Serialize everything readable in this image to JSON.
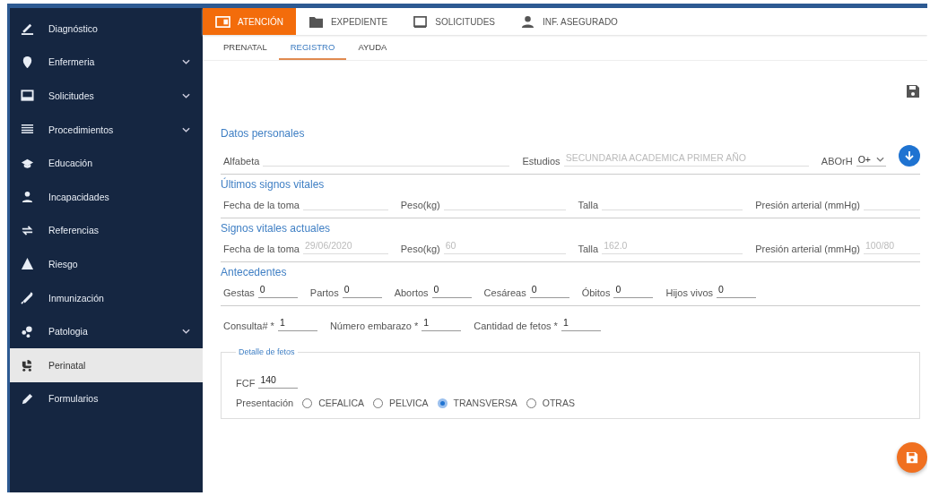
{
  "sidebar": {
    "items": [
      {
        "label": "Diagnóstico",
        "has_submenu": false,
        "selected": false
      },
      {
        "label": "Enfermeria",
        "has_submenu": true,
        "selected": false
      },
      {
        "label": "Solicitudes",
        "has_submenu": true,
        "selected": false
      },
      {
        "label": "Procedimientos",
        "has_submenu": true,
        "selected": false
      },
      {
        "label": "Educación",
        "has_submenu": false,
        "selected": false
      },
      {
        "label": "Incapacidades",
        "has_submenu": false,
        "selected": false
      },
      {
        "label": "Referencias",
        "has_submenu": false,
        "selected": false
      },
      {
        "label": "Riesgo",
        "has_submenu": false,
        "selected": false
      },
      {
        "label": "Inmunización",
        "has_submenu": false,
        "selected": false
      },
      {
        "label": "Patologia",
        "has_submenu": true,
        "selected": false
      },
      {
        "label": "Perinatal",
        "has_submenu": false,
        "selected": true
      },
      {
        "label": "Formularios",
        "has_submenu": false,
        "selected": false
      }
    ]
  },
  "top_tabs": [
    {
      "label": "ATENCIÓN",
      "selected": true
    },
    {
      "label": "EXPEDIENTE",
      "selected": false
    },
    {
      "label": "SOLICITUDES",
      "selected": false
    },
    {
      "label": "INF. ASEGURADO",
      "selected": false
    }
  ],
  "sub_tabs": [
    {
      "label": "PRENATAL",
      "selected": false
    },
    {
      "label": "REGISTRO",
      "selected": true
    },
    {
      "label": "AYUDA",
      "selected": false
    }
  ],
  "sections": [
    {
      "title": "Datos personales",
      "fields": [
        {
          "kind": "text",
          "label": "Alfabeta"
        },
        {
          "kind": "text",
          "label": "Estudios",
          "value": "SECUNDARIA ACADEMICA PRIMER AÑO",
          "disabled": true
        },
        {
          "kind": "select",
          "label": "ABOrH",
          "value": "O+"
        },
        {
          "kind": "button"
        }
      ]
    },
    {
      "title": "Últimos signos vitales",
      "fields": [
        {
          "kind": "text",
          "label": "Fecha de la toma"
        },
        {
          "kind": "text",
          "label": "Peso(kg)"
        },
        {
          "kind": "text",
          "label": "Talla"
        },
        {
          "kind": "text",
          "label": "Presión arterial (mmHg)"
        }
      ]
    },
    {
      "title": "Signos vitales actuales",
      "fields": [
        {
          "kind": "text",
          "label": "Fecha de la toma",
          "value": "29/06/2020",
          "disabled": true
        },
        {
          "kind": "text",
          "label": "Peso(kg)",
          "value": "60",
          "disabled": true
        },
        {
          "kind": "text",
          "label": "Talla",
          "value": "162.0",
          "disabled": true
        },
        {
          "kind": "text",
          "label": "Presión arterial (mmHg)",
          "value": "100/80",
          "disabled": true
        }
      ]
    },
    {
      "title": "Antecedentes",
      "fields": [
        {
          "kind": "short",
          "label": "Gestas",
          "value": "0",
          "disabled": false
        },
        {
          "kind": "short",
          "label": "Partos",
          "value": "0",
          "disabled": false
        },
        {
          "kind": "short",
          "label": "Abortos",
          "value": "0",
          "disabled": false
        },
        {
          "kind": "short",
          "label": "Cesáreas",
          "value": "0",
          "disabled": false
        },
        {
          "kind": "short",
          "label": "Óbitos",
          "value": "0",
          "disabled": false
        },
        {
          "kind": "short",
          "label": "Hijos vivos",
          "value": "0",
          "disabled": false
        }
      ]
    },
    {
      "fields": [
        {
          "kind": "short",
          "label": "Consulta# *",
          "value": "1",
          "disabled": false
        },
        {
          "kind": "short",
          "label": "Número embarazo *",
          "value": "1",
          "disabled": false
        },
        {
          "kind": "short",
          "label": "Cantidad de fetos *",
          "value": "1",
          "disabled": false
        }
      ]
    }
  ],
  "fetal_detail": {
    "legend": "Detalle de fetos",
    "fcf": {
      "label": "FCF",
      "value": "140"
    },
    "presentation": {
      "label": "Presentación",
      "options": [
        {
          "label": "CEFALICA",
          "selected": false
        },
        {
          "label": "PELVICA",
          "selected": false
        },
        {
          "label": "TRANSVERSA",
          "selected": true
        },
        {
          "label": "OTRAS",
          "selected": false
        }
      ]
    }
  }
}
